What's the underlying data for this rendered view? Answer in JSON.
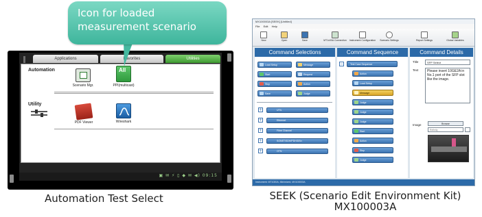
{
  "callout": {
    "text_line1": "Icon for loaded",
    "text_line2": "measurement scenario"
  },
  "left_panel": {
    "tabs": {
      "applications": "Applications",
      "favorites": "Favorites",
      "utilities": "Utilities"
    },
    "sections": {
      "automation": {
        "label": "Automation",
        "apps": [
          {
            "label": "Scenario Mgr.",
            "color": "#2e7d32"
          },
          {
            "label": "PPI(multicast)",
            "color": "#39b34a",
            "badge": "All"
          }
        ]
      },
      "utility": {
        "label": "Utility",
        "apps": [
          {
            "label": "",
            "color": "#555555"
          },
          {
            "label": "PDF Viewer",
            "color": "#c0392b"
          },
          {
            "label": "Wireshark",
            "color": "#1e6bb8"
          }
        ]
      }
    },
    "status_icons": "▣ ✉ ⚡ ▯ ◆ ✉ ◀) 09:15",
    "caption": "Automation Test  Select"
  },
  "right_panel": {
    "window_title": "MX100003A [SEEK] [Untitled]",
    "menu": [
      "File",
      "Edit",
      "Help"
    ],
    "toolbar": [
      "New",
      "Open",
      "Save",
      "MT1x00A Connection",
      "Instrument Configuration",
      "Scenario Settings",
      "Report Settings",
      "Global Variables"
    ],
    "panes": {
      "selections": "Command Selections",
      "sequence": "Command Sequence",
      "details": "Command Details"
    },
    "command_buttons": [
      "Load Setup",
      "Message",
      "Start",
      "Request",
      "Stop",
      "Action",
      "Save",
      "Judge"
    ],
    "categories": [
      "UTIL",
      "Ethernet",
      "Fibre Channel",
      "SONET/SDH/PDH/DSn",
      "OTN"
    ],
    "sequence_items": [
      "Test Case Sequence",
      "Action",
      "Load Setup",
      "Message",
      "Judge",
      "Judge",
      "Judge",
      "Start",
      "Action",
      "Stop",
      "Judge"
    ],
    "details": {
      "title_label": "Title",
      "title_value": "SFP Select",
      "text_label": "Text",
      "text_value": "Please insert 10GE2A in No.1 port of the SFP slot like the image.",
      "image_label": "Image",
      "browse_label": "Browse",
      "image_path": "Rxfinity"
    },
    "status_text": "Instrument: MT1000A, Minimized, MX100003A",
    "caption_line1": "SEEK (Scenario Edit Environment Kit)",
    "caption_line2": "MX100003A"
  }
}
